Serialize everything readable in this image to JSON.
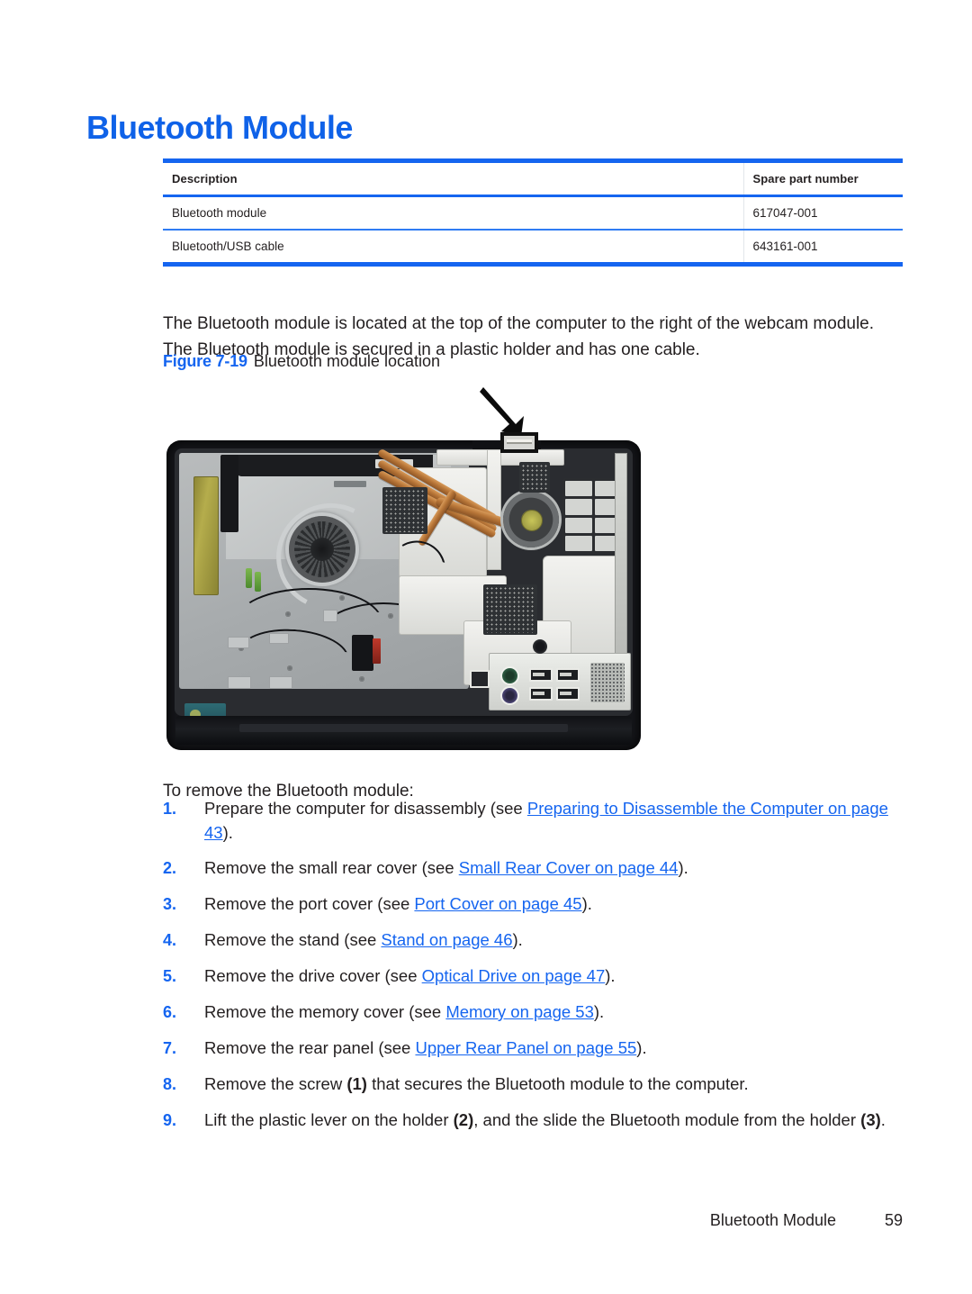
{
  "document": {
    "title": "Bluetooth Module",
    "title_color": "#0f62e8"
  },
  "spec_table": {
    "headers": [
      "Description",
      "Spare part number"
    ],
    "rows": [
      {
        "description": "Bluetooth module",
        "spare_part_number": "617047-001"
      },
      {
        "description": "Bluetooth/USB cable",
        "spare_part_number": "643161-001"
      }
    ],
    "rule_color": "#1565f0"
  },
  "intro": {
    "paragraph": "The Bluetooth module is located at the top of the computer to the right of the webcam module. The Bluetooth module is secured in a plastic holder and has one cable."
  },
  "figure": {
    "label": "Figure 7-19",
    "description": "Bluetooth module location",
    "alt": "Photograph of the rear of an all-in-one computer with the rear panel removed, showing the Bluetooth module location highlighted by a black callout box and an arrow near the top center.",
    "callout_icon": "bluetooth-module-highlight-box",
    "arrow_icon": "down-right-arrow-icon"
  },
  "procedure": {
    "lead_in": "To remove the Bluetooth module:",
    "steps": [
      {
        "number": "1.",
        "prefix": "Prepare the computer for disassembly (see ",
        "link": "Preparing to Disassemble the Computer on page 43",
        "suffix": ")."
      },
      {
        "number": "2.",
        "prefix": "Remove the small rear cover (see ",
        "link": "Small Rear Cover on page 44",
        "suffix": ")."
      },
      {
        "number": "3.",
        "prefix": "Remove the port cover (see ",
        "link": "Port Cover on page 45",
        "suffix": ")."
      },
      {
        "number": "4.",
        "prefix": "Remove the stand (see ",
        "link": "Stand on page 46",
        "suffix": ")."
      },
      {
        "number": "5.",
        "prefix": "Remove the drive cover (see ",
        "link": "Optical Drive on page 47",
        "suffix": ")."
      },
      {
        "number": "6.",
        "prefix": "Remove the memory cover (see ",
        "link": "Memory on page 53",
        "suffix": ")."
      },
      {
        "number": "7.",
        "prefix": "Remove the rear panel (see ",
        "link": "Upper Rear Panel on page 55",
        "suffix": ")."
      },
      {
        "number": "8.",
        "prefix": "Remove the screw ",
        "callout1": "(1)",
        "mid": " that secures the Bluetooth module to the computer.",
        "link": "",
        "suffix": ""
      },
      {
        "number": "9.",
        "prefix": "Lift the plastic lever on the holder ",
        "callout1": "(2)",
        "mid": ", and the slide the Bluetooth module from the holder ",
        "callout2": "(3)",
        "suffix": "."
      }
    ]
  },
  "footer": {
    "section_title": "Bluetooth Module",
    "page_number": "59"
  }
}
